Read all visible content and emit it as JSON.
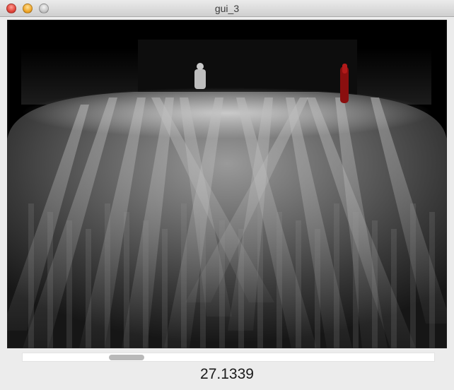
{
  "window": {
    "title": "gui_3"
  },
  "viewport": {
    "description_icon": "3d-render-viewport"
  },
  "slider": {
    "value_fraction": 0.23
  },
  "readout": {
    "value": "27.1339"
  }
}
